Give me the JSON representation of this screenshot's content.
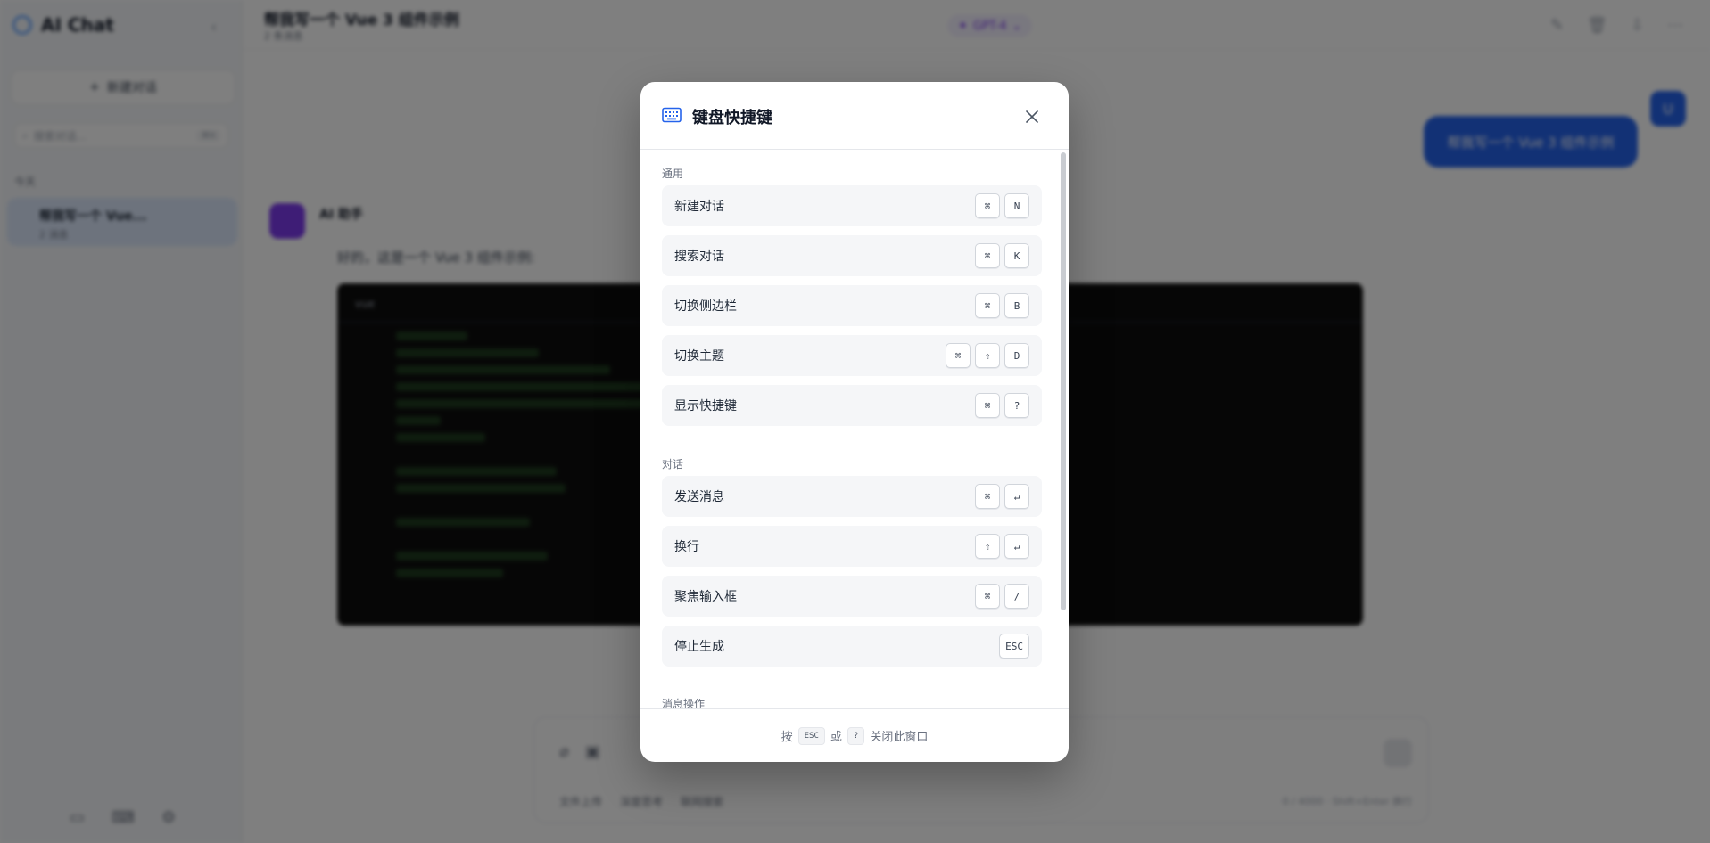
{
  "app": {
    "name": "AI Chat",
    "new_chat": "新建对话",
    "search_placeholder": "搜索对话...",
    "search_shortcut": "⌘K",
    "group_today": "今天",
    "conversation": {
      "title": "帮我写一个 Vue...",
      "meta": "2 消息"
    },
    "chat_title": "帮我写一个 Vue 3 组件示例",
    "chat_sub": "2 条消息",
    "model": "GPT-4",
    "user_message": "帮我写一个 Vue 3 组件示例",
    "user_avatar": "U",
    "ai_name": "AI 助手",
    "ai_text": "好的，这是一个 Vue 3 组件示例:",
    "code_lang": "vue",
    "composer_chips": [
      "文件上传",
      "深度思考",
      "联网搜索"
    ],
    "composer_right": "0 / 4000 · Shift+Enter 换行"
  },
  "modal": {
    "title": "键盘快捷键",
    "sections": [
      {
        "label": "通用",
        "items": [
          {
            "label": "新建对话",
            "keys": [
              "⌘",
              "N"
            ]
          },
          {
            "label": "搜索对话",
            "keys": [
              "⌘",
              "K"
            ]
          },
          {
            "label": "切换侧边栏",
            "keys": [
              "⌘",
              "B"
            ]
          },
          {
            "label": "切换主题",
            "keys": [
              "⌘",
              "⇧",
              "D"
            ]
          },
          {
            "label": "显示快捷键",
            "keys": [
              "⌘",
              "?"
            ]
          }
        ]
      },
      {
        "label": "对话",
        "items": [
          {
            "label": "发送消息",
            "keys": [
              "⌘",
              "↵"
            ]
          },
          {
            "label": "换行",
            "keys": [
              "⇧",
              "↵"
            ]
          },
          {
            "label": "聚焦输入框",
            "keys": [
              "⌘",
              "/"
            ]
          },
          {
            "label": "停止生成",
            "keys": [
              "ESC"
            ]
          }
        ]
      },
      {
        "label": "消息操作",
        "items": []
      }
    ],
    "footer": {
      "prefix": "按",
      "key1": "ESC",
      "or": "或",
      "key2": "?",
      "suffix": "关闭此窗口"
    }
  },
  "colors": {
    "accent": "#2563eb",
    "overlay": "rgba(0,0,0,0.5)",
    "row_bg": "#f5f6f8"
  }
}
